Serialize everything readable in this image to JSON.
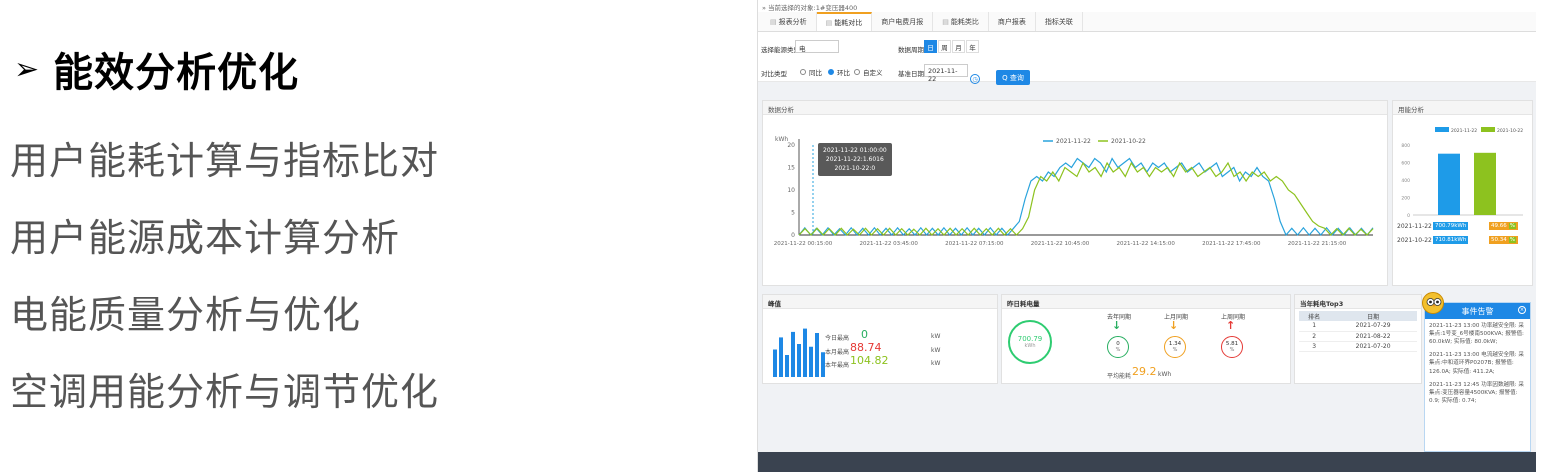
{
  "slide": {
    "marker": "➢",
    "title": "能效分析优化",
    "bullets": [
      "用户能耗计算与指标比对",
      "用户能源成本计算分析",
      "电能质量分析与优化",
      "空调用能分析与调节优化"
    ]
  },
  "app": {
    "breadcrumb": "» 当前选择的对象:1#变压器400",
    "tabs": [
      {
        "label": "报表分析",
        "icon": "table-icon"
      },
      {
        "label": "能耗对比",
        "icon": "compare-icon",
        "active": true
      },
      {
        "label": "商户电费月报",
        "icon": ""
      },
      {
        "label": "能耗类比",
        "icon": "chart-icon"
      },
      {
        "label": "商户报表",
        "icon": ""
      },
      {
        "label": "指标关联",
        "icon": ""
      }
    ],
    "filters": {
      "energy_type_label": "选择能源类型",
      "energy_type_value": "电",
      "period_label": "数据周期",
      "period_options": [
        "日",
        "周",
        "月",
        "年"
      ],
      "compare_label": "对比类型",
      "compare_options": [
        "同比",
        "环比",
        "自定义"
      ],
      "date_label": "基准日期",
      "date_value": "2021-11-22",
      "query_label": "Q 查询"
    },
    "data_panel_title": "数据分析",
    "usage_panel_title": "用能分析",
    "peak_panel_title": "峰值",
    "yesterday_panel_title": "昨日耗电量",
    "top3_panel_title": "当年耗电Top3",
    "tooltip": {
      "line1": "2021-11-22 01:00:00",
      "line2": "2021-11-22:1.6016",
      "line3": "2021-10-22:0"
    },
    "peak": {
      "today_label": "今日最高",
      "today_value": "0",
      "month_label": "本月最高",
      "month_value": "88.74",
      "year_label": "本年最高",
      "year_value": "104.82",
      "unit": "kW"
    },
    "yesterday": {
      "total_value": "700.79",
      "total_unit": "kWh",
      "items": [
        {
          "label": "去年同期",
          "value": "0",
          "unit": "%",
          "dir": "down",
          "color": "#27ae60"
        },
        {
          "label": "上月同期",
          "value": "1.34",
          "unit": "%",
          "dir": "down",
          "color": "#f0a020"
        },
        {
          "label": "上周同期",
          "value": "5.81",
          "unit": "%",
          "dir": "up",
          "color": "#e53935"
        }
      ],
      "avg_label": "平均能耗",
      "avg_value": "29.2",
      "avg_unit": "kWh"
    },
    "top3": {
      "headers": [
        "排名",
        "日期"
      ],
      "rows": [
        [
          "1",
          "2021-07-29"
        ],
        [
          "2",
          "2021-08-22"
        ],
        [
          "3",
          "2021-07-20"
        ]
      ]
    },
    "usage_bar": {
      "rows": [
        {
          "date": "2021-11-22",
          "value": "700.79kWh",
          "pct": "49.66",
          "pct_unit": "%"
        },
        {
          "date": "2021-10-22",
          "value": "710.81kWh",
          "pct": "50.34",
          "pct_unit": "%"
        }
      ]
    },
    "alarm": {
      "title": "事件告警",
      "events": [
        "2021-11-23 13:00 功率越安全限: 采集点:1号变_6号楼南500KVA; 报警值: 60.0kW; 实际值: 80.0kW;",
        "2021-11-23 13:00 电流越安全限: 采集点:中和道环界P0207B; 报警值: 126.0A; 实际值: 411.2A;",
        "2021-11-23 12:45 功率因数越限: 采集点:变压器容量4500KVA; 报警值: 0.9; 实际值: 0.74;"
      ]
    }
  },
  "chart_data": [
    {
      "type": "line",
      "ylabel": "kWh",
      "ylim": [
        0,
        20
      ],
      "yticks": [
        0,
        5,
        10,
        15,
        20
      ],
      "x_tick_labels": [
        "2021-11-22 00:15:00",
        "2021-11-22 03:45:00",
        "2021-11-22 07:15:00",
        "2021-11-22 10:45:00",
        "2021-11-22 14:15:00",
        "2021-11-22 17:45:00",
        "2021-11-22 21:15:00"
      ],
      "legend": [
        "2021-11-22",
        "2021-10-22"
      ],
      "legend_position": "top",
      "series": [
        {
          "name": "2021-11-22",
          "color": "#29a3dc",
          "values": [
            0,
            1.6,
            0,
            1.5,
            0,
            1.6,
            0,
            1.4,
            0,
            1.6,
            0,
            1.5,
            0,
            1.6,
            0,
            1.5,
            0,
            1.6,
            0,
            1.4,
            0,
            1.6,
            0,
            1.5,
            0,
            1.6,
            0,
            1.5,
            0,
            1.6,
            0,
            1.5,
            0,
            1.6,
            0,
            1.5,
            0,
            1.5,
            3,
            8,
            12,
            13,
            12,
            14,
            13,
            15,
            16,
            15,
            17,
            16,
            15,
            17,
            16,
            14,
            17,
            15,
            16,
            17,
            15,
            16,
            14,
            16,
            15,
            16,
            14,
            15,
            16,
            14,
            15,
            16,
            14,
            15,
            16,
            13,
            14,
            15,
            12,
            14,
            13,
            15,
            13,
            12,
            8,
            3,
            0,
            1.5,
            0,
            1.6,
            0,
            1.5,
            0,
            1.6,
            0,
            1.5,
            0,
            1.6,
            0,
            1.5,
            0,
            1.6
          ]
        },
        {
          "name": "2021-10-22",
          "color": "#8dc21f",
          "values": [
            0,
            1.4,
            0,
            1.5,
            0,
            1.4,
            0,
            1.5,
            0,
            1.3,
            0,
            1.5,
            0,
            1.4,
            0,
            1.5,
            0,
            1.4,
            0,
            1.3,
            0,
            1.5,
            0,
            1.4,
            0,
            1.5,
            0,
            1.4,
            0,
            1.5,
            0,
            1.4,
            0,
            1.5,
            0,
            1.4,
            0,
            1.4,
            4,
            10,
            13,
            12,
            14,
            12,
            15,
            14,
            13,
            16,
            14,
            15,
            13,
            16,
            14,
            15,
            13,
            16,
            14,
            15,
            13,
            15,
            14,
            15,
            13,
            16,
            14,
            15,
            13,
            14,
            15,
            13,
            14,
            16,
            13,
            14,
            12,
            14,
            13,
            14,
            12,
            13,
            12,
            10,
            9,
            7,
            5,
            3,
            2,
            1.5,
            0,
            1.4,
            0,
            1.5,
            0,
            1.3,
            0,
            1.4
          ]
        }
      ]
    },
    {
      "type": "bar",
      "categories": [
        "2021-11-22",
        "2021-10-22"
      ],
      "values": [
        700.79,
        710.81
      ],
      "colors": [
        "#1e9be8",
        "#8dc21f"
      ],
      "legend": [
        "2021-11-22",
        "2021-10-22"
      ],
      "legend_position": "top-right",
      "yticks": [
        0,
        200,
        400,
        600,
        800
      ],
      "ylim": [
        0,
        800
      ]
    },
    {
      "type": "bar",
      "title": "峰值",
      "values": [
        50,
        72,
        40,
        82,
        60,
        88,
        55,
        80,
        45
      ],
      "colors": [
        "#1e88e5"
      ]
    }
  ]
}
